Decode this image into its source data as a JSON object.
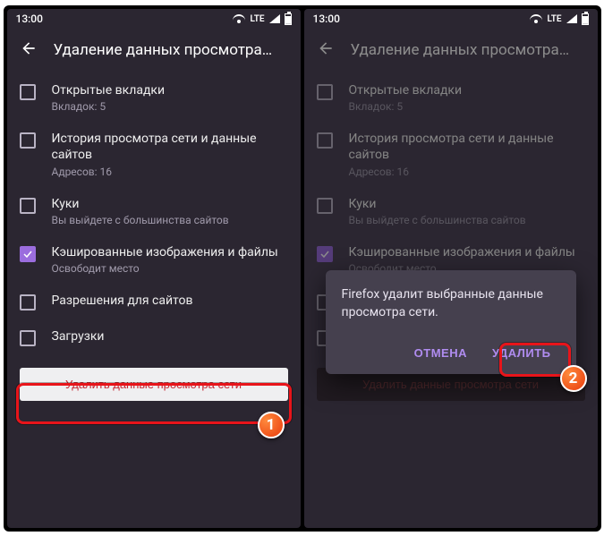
{
  "status": {
    "time": "13:00",
    "lte": "LTE"
  },
  "header": {
    "title": "Удаление данных просмотра…"
  },
  "items": [
    {
      "title": "Открытые вкладки",
      "sub": "Вкладок: 5",
      "checked": false
    },
    {
      "title": "История просмотра сети и данные сайтов",
      "sub": "Адресов: 16",
      "checked": false
    },
    {
      "title": "Куки",
      "sub": "Вы выйдете с большинства сайтов",
      "checked": false
    },
    {
      "title": "Кэшированные изображения и файлы",
      "sub": "Освободит место",
      "checked": true
    },
    {
      "title": "Разрешения для сайтов",
      "sub": "",
      "checked": false
    },
    {
      "title": "Загрузки",
      "sub": "",
      "checked": false
    }
  ],
  "delete_button": "Удалить данные просмотра сети",
  "dialog": {
    "text": "Firefox удалит выбранные данные просмотра сети.",
    "cancel": "ОТМЕНА",
    "confirm": "УДАЛИТЬ"
  },
  "markers": {
    "m1": "1",
    "m2": "2"
  }
}
